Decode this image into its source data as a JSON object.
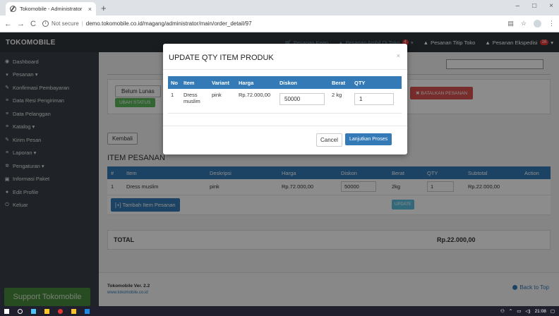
{
  "browser": {
    "tab_title": "Tokomobile - Administrator",
    "tab_close": "×",
    "new_tab": "+",
    "not_secure": "Not secure",
    "url": "demo.tokomobile.co.id/magang/administrator/main/order_detail/97",
    "window_controls": [
      "–",
      "□",
      "×"
    ]
  },
  "topnav": {
    "brand": "TOKOMOBILE",
    "items": [
      {
        "label": "Pesanan Keep",
        "badge": ""
      },
      {
        "label": "Pesanan Ambil Di Toko",
        "badge": "4"
      },
      {
        "label": "Pesanan Titip Toko",
        "badge": ""
      },
      {
        "label": "Pesanan Ekspedisi",
        "badge": "16"
      }
    ]
  },
  "sidebar": {
    "items": [
      {
        "icon": "dashboard-icon",
        "label": "Dashboard"
      },
      {
        "icon": "cart-icon",
        "label": "Pesanan ▾"
      },
      {
        "icon": "edit-icon",
        "label": "Konfirmasi Pembayaran"
      },
      {
        "icon": "list-icon",
        "label": "Data Resi Pengiriman"
      },
      {
        "icon": "list-icon",
        "label": "Data Pelanggan"
      },
      {
        "icon": "list-icon",
        "label": "Katalog ▾"
      },
      {
        "icon": "edit-icon",
        "label": "Kirim Pesan"
      },
      {
        "icon": "list-icon",
        "label": "Laporan ▾"
      },
      {
        "icon": "gear-icon",
        "label": "Pengaturan ▾"
      },
      {
        "icon": "info-icon",
        "label": "Informasi Paket"
      },
      {
        "icon": "user-icon",
        "label": "Edit Profile"
      },
      {
        "icon": "power-icon",
        "label": "Keluar"
      }
    ],
    "support": "Support Tokomobile"
  },
  "status": {
    "payment_status": "Belum Lunas",
    "ubah_status": "UBAH STATUS",
    "batalkan": "✖ BATALKAN PESANAN"
  },
  "main": {
    "kembali": "Kembali",
    "section_title": "ITEM PESANAN",
    "columns": [
      "#",
      "Item",
      "Deskripsi",
      "Harga",
      "Diskon",
      "Berat",
      "QTY",
      "Subtotal",
      "Action"
    ],
    "row": {
      "no": "1",
      "item": "Dress muslim",
      "deskripsi": "pink",
      "harga": "Rp.72.000,00",
      "diskon": "50000",
      "berat": "2kg",
      "qty": "1",
      "subtotal": "Rp.22.000,00"
    },
    "tambah": "[+] Tambah Item Pesanan",
    "update": "UPDATE",
    "total_label": "TOTAL",
    "total_value": "Rp.22.000,00"
  },
  "footer": {
    "version": "Tokomobile Ver. 2.2",
    "site": "www.tokomobile.co.id",
    "back_to_top": "Back to Top"
  },
  "modal": {
    "title": "UPDATE QTY ITEM PRODUK",
    "close": "×",
    "columns": [
      "No",
      "Item",
      "Variant",
      "Harga",
      "Diskon",
      "Berat",
      "QTY"
    ],
    "row": {
      "no": "1",
      "item": "Dress muslim",
      "variant": "pink",
      "harga": "Rp.72.000,00",
      "diskon": "50000",
      "berat": "2 kg",
      "qty": "1"
    },
    "cancel": "Cancel",
    "proceed": "Lanjutkan Proses"
  },
  "taskbar": {
    "clock": "21:08"
  }
}
